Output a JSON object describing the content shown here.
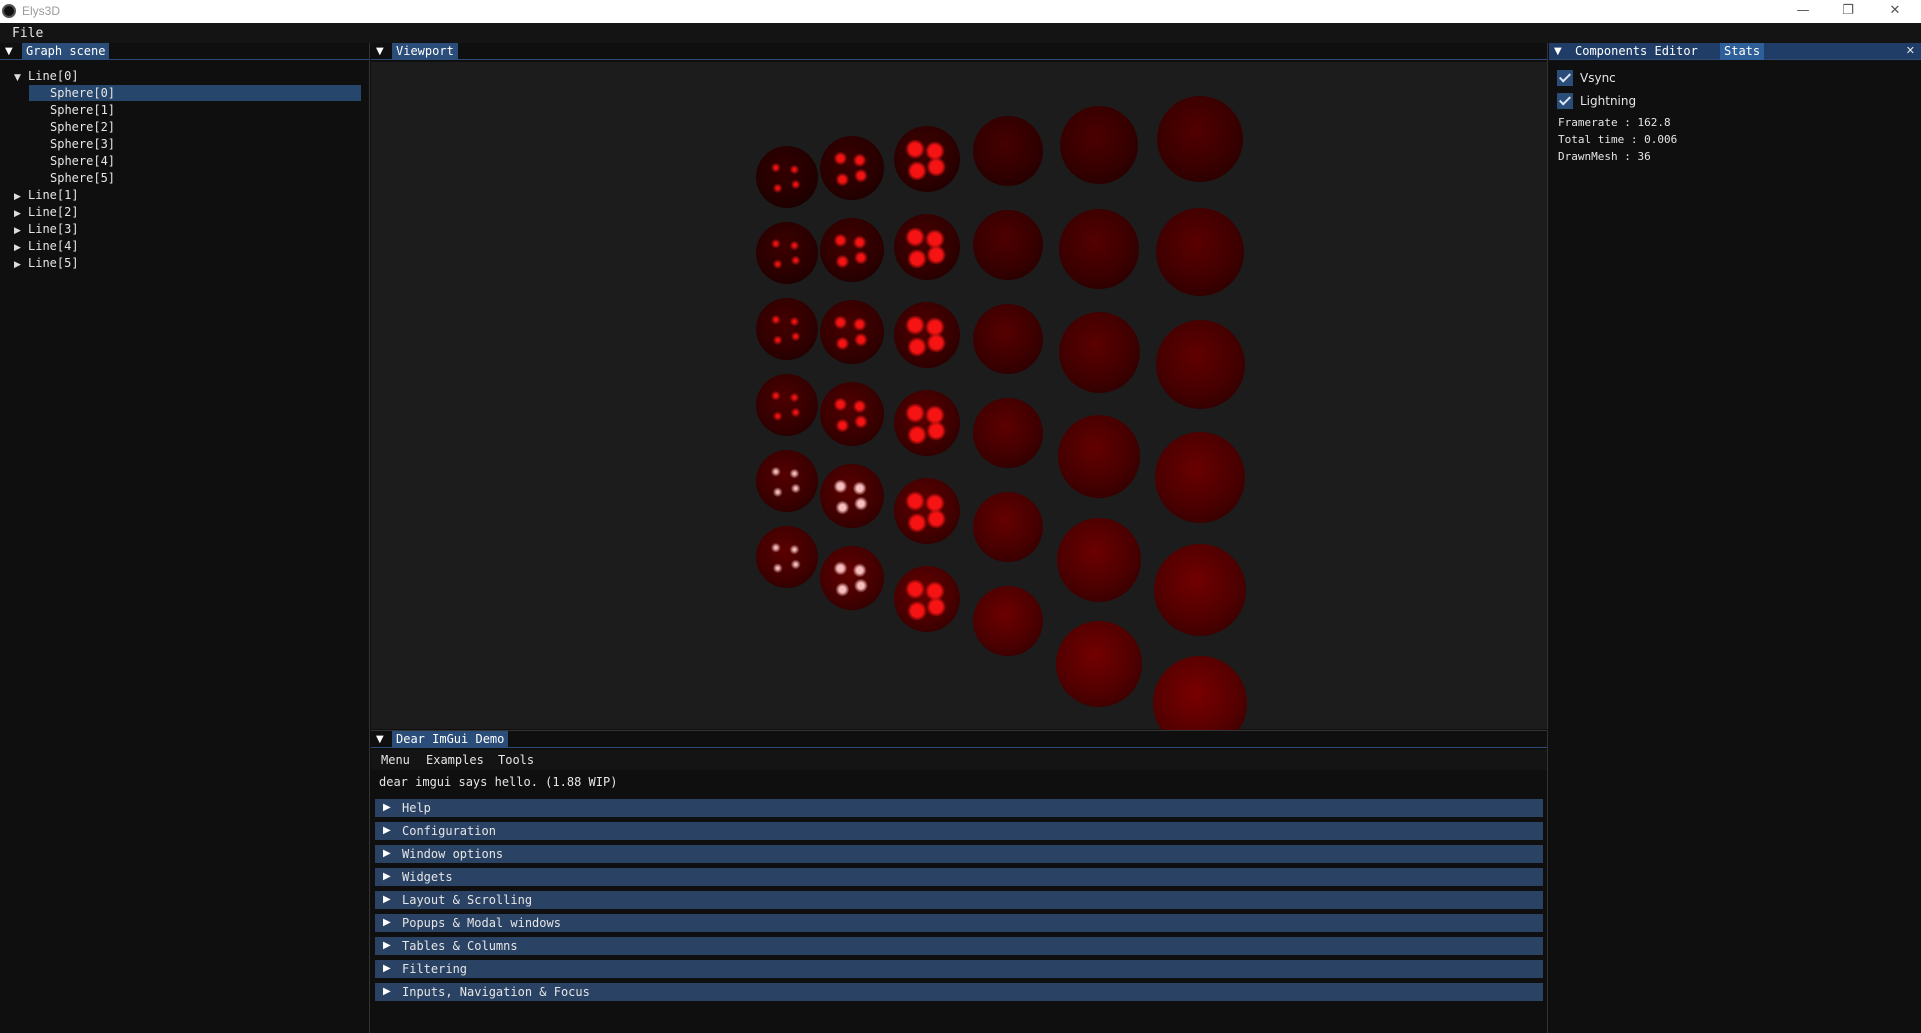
{
  "window": {
    "title": "Elys3D",
    "minimize": "—",
    "restore": "❐",
    "close": "✕"
  },
  "menubar": {
    "file": "File"
  },
  "graph_scene": {
    "tab": "Graph scene",
    "nodes": [
      {
        "label": "Line[0]",
        "expanded": true,
        "children": [
          "Sphere[0]",
          "Sphere[1]",
          "Sphere[2]",
          "Sphere[3]",
          "Sphere[4]",
          "Sphere[5]"
        ]
      },
      {
        "label": "Line[1]"
      },
      {
        "label": "Line[2]"
      },
      {
        "label": "Line[3]"
      },
      {
        "label": "Line[4]"
      },
      {
        "label": "Line[5]"
      }
    ],
    "selected": "Sphere[0]"
  },
  "viewport": {
    "tab": "Viewport",
    "grid_rows": 6,
    "grid_cols": 6,
    "sphere_color": "#8a0000"
  },
  "right_panel": {
    "tab_components": "Components Editor",
    "tab_stats": "Stats",
    "close": "✕",
    "vsync_label": "Vsync",
    "vsync_checked": true,
    "lightning_label": "Lightning",
    "lightning_checked": true,
    "framerate": "Framerate : 162.8",
    "total_time": "Total time : 0.006",
    "drawn_mesh": "DrawnMesh : 36"
  },
  "demo": {
    "tab": "Dear ImGui Demo",
    "menu": [
      "Menu",
      "Examples",
      "Tools"
    ],
    "hello": "dear imgui says hello. (1.88 WIP)",
    "sections": [
      "Help",
      "Configuration",
      "Window options",
      "Widgets",
      "Layout & Scrolling",
      "Popups & Modal windows",
      "Tables & Columns",
      "Filtering",
      "Inputs, Navigation & Focus"
    ]
  },
  "colors": {
    "accent": "#2a4d7a",
    "header": "#2a4263",
    "selection": "#26466c"
  },
  "icons": {
    "collapse": "triangle-down-icon",
    "tree_open": "triangle-down-icon",
    "tree_closed": "triangle-right-icon"
  }
}
